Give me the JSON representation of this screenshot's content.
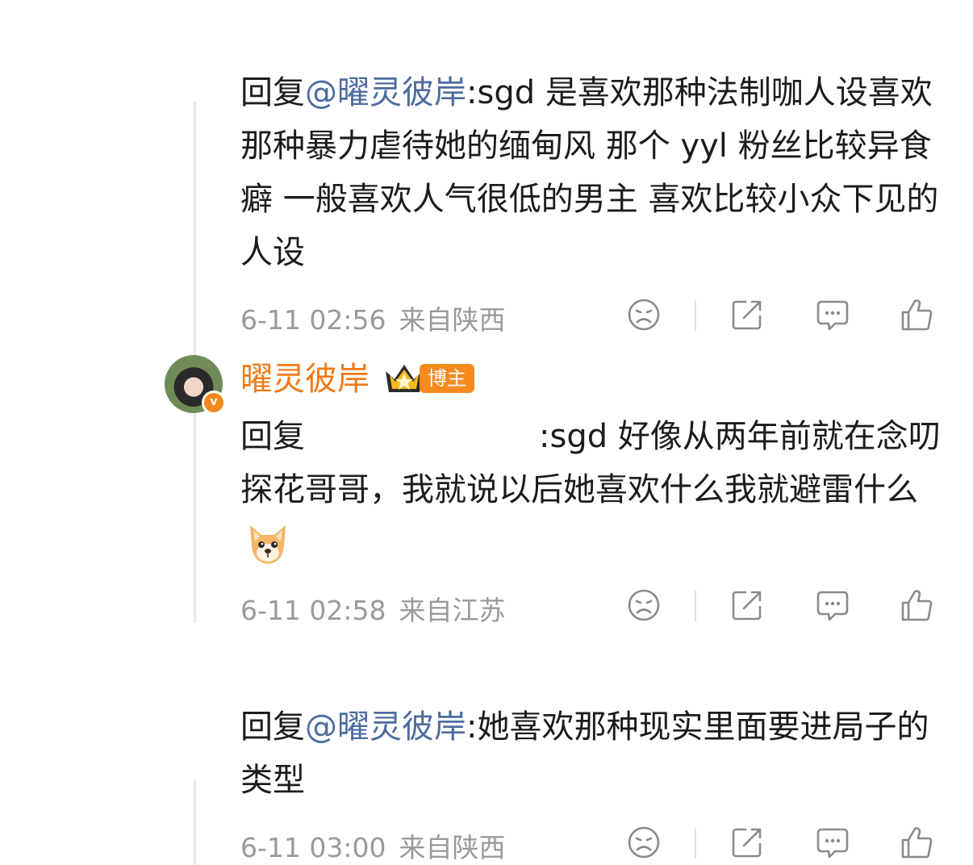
{
  "comments": [
    {
      "prefix": "回复",
      "mention": "@曜灵彼岸",
      "text": ":sgd 是喜欢那种法制咖人设喜欢那种暴力虐待她的缅甸风 那个 yyl 粉丝比较异食癖 一般喜欢人气很低的男主 喜欢比较小众下见的人设",
      "time": "6-11 02:56",
      "location": "来自陕西"
    },
    {
      "username": "曜灵彼岸",
      "host_tag": "博主",
      "prefix": "回复",
      "text": ":sgd 好像从两年前就在念叨探花哥哥，我就说以后她喜欢什么我就避雷什么",
      "time": "6-11 02:58",
      "location": "来自江苏"
    },
    {
      "prefix": "回复",
      "mention": "@曜灵彼岸",
      "text": ":她喜欢那种现实里面要进局子的类型",
      "time": "6-11 03:00",
      "location": "来自陕西"
    }
  ],
  "actions": [
    "dislike-icon",
    "share-icon",
    "comment-icon",
    "like-icon"
  ],
  "colors": {
    "mention": "#4c6c9e",
    "username": "#f07a18",
    "host_tag_bg": "#f58a1f",
    "meta": "#9a9a9a"
  }
}
